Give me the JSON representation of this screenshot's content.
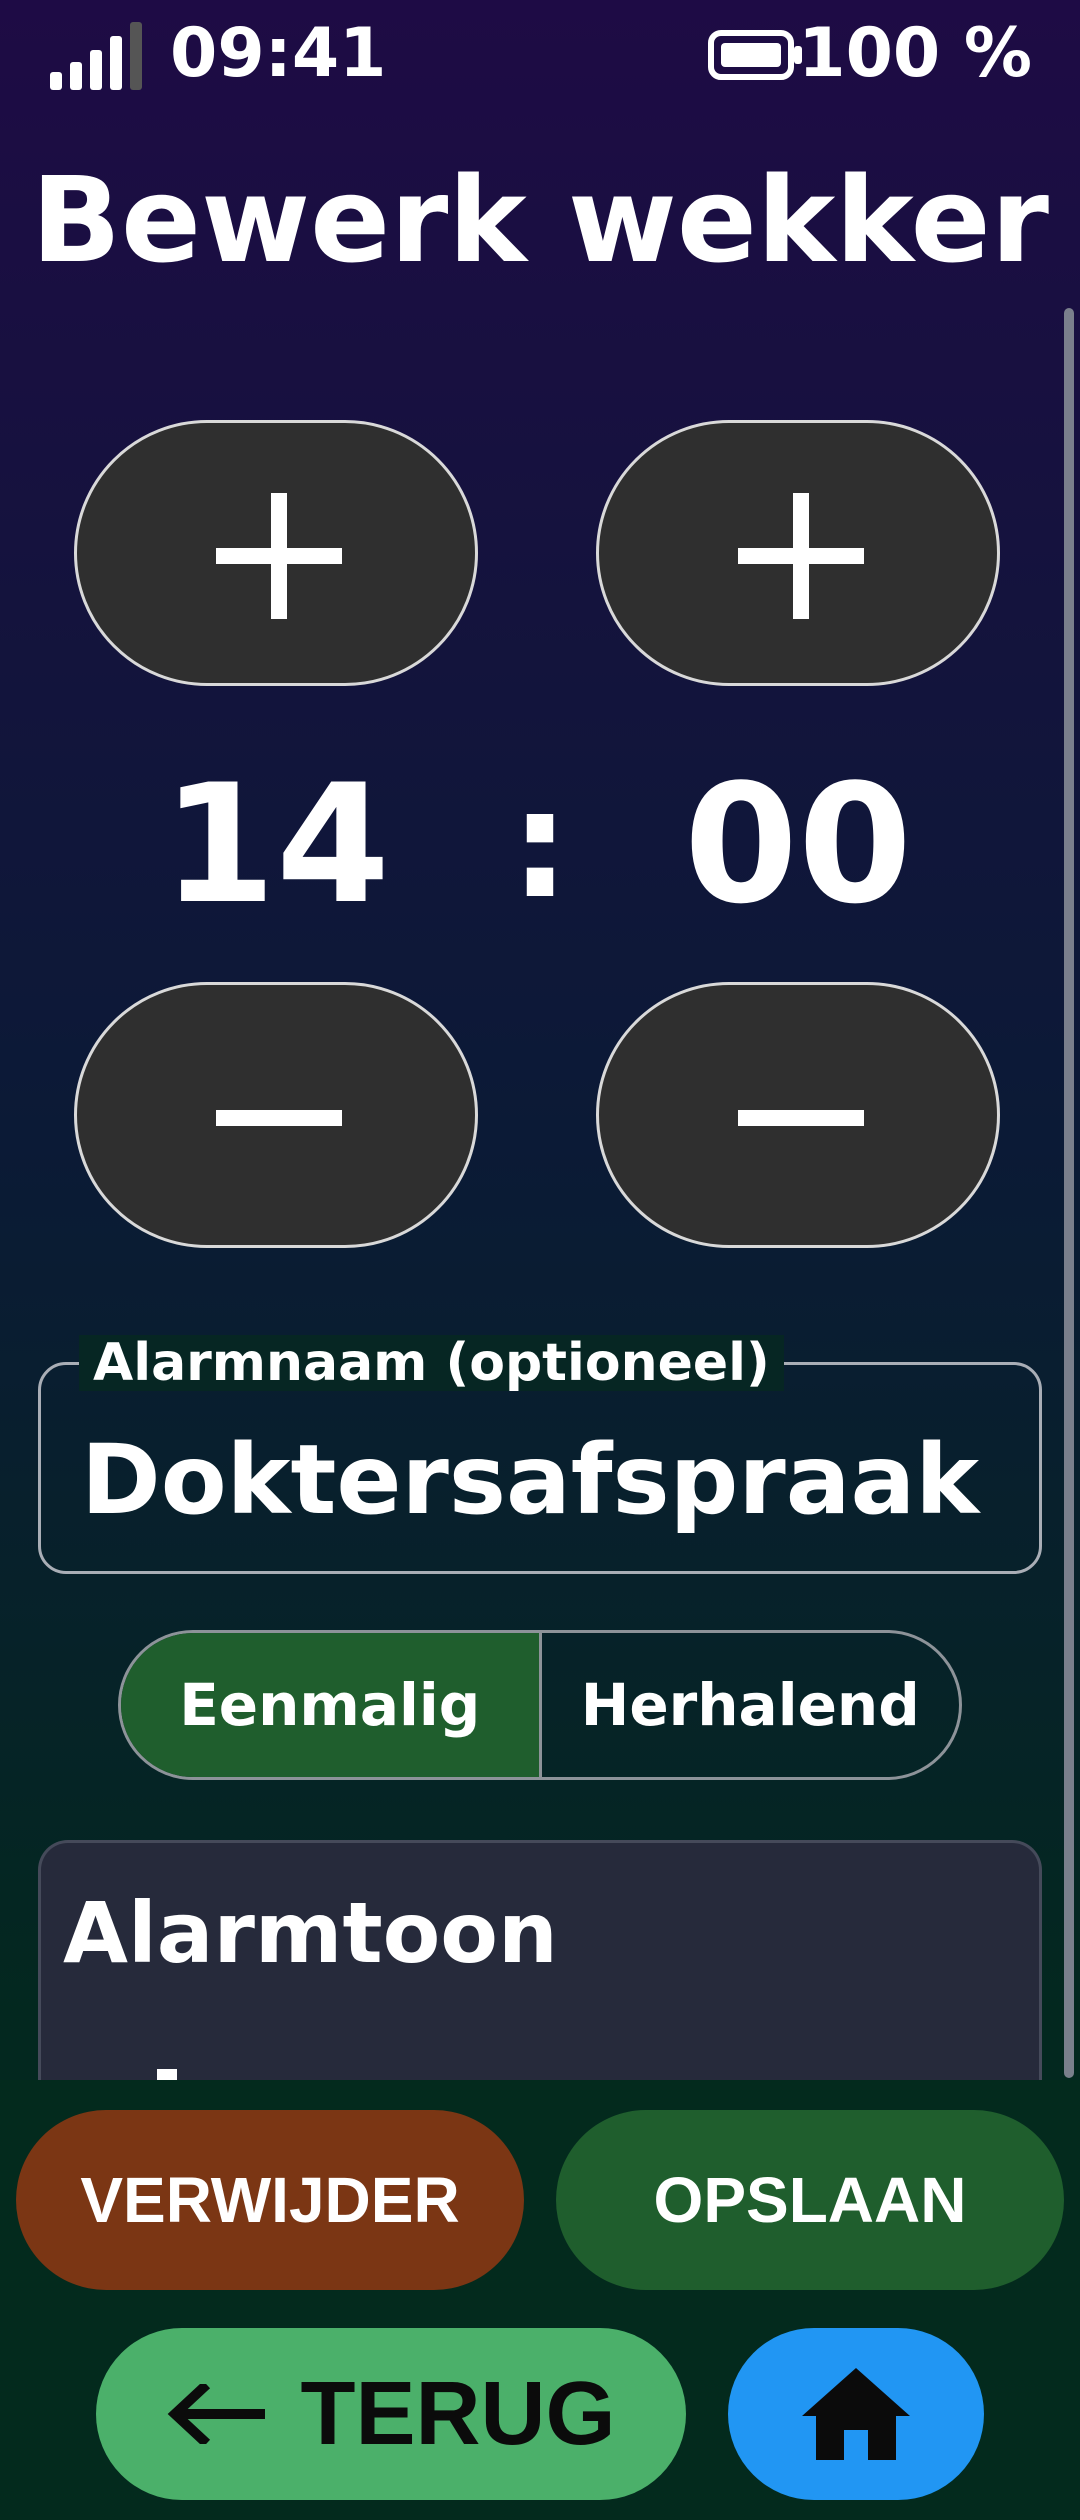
{
  "status": {
    "time": "09:41",
    "battery_text": "100 %"
  },
  "title": "Bewerk wekker",
  "time_picker": {
    "hours": "14",
    "separator": ":",
    "minutes": "00"
  },
  "name_field": {
    "label": "Alarmnaam (optioneel)",
    "value": "Doktersafspraak"
  },
  "repeat_toggle": {
    "options": [
      "Eenmalig",
      "Herhalend"
    ],
    "selected": "Eenmalig"
  },
  "tone_section": {
    "title": "Alarmtoon"
  },
  "actions": {
    "delete_label": "VERWIJDER",
    "save_label": "OPSLAAN",
    "back_label": "TERUG"
  },
  "colors": {
    "accent_green": "#1f5e2d",
    "delete_brown": "#7b3614",
    "back_green": "#4bb06a",
    "home_blue": "#2196f3"
  },
  "icons": [
    "signal-icon",
    "battery-icon",
    "plus-icon",
    "minus-icon",
    "arrow-left-icon",
    "home-icon"
  ]
}
